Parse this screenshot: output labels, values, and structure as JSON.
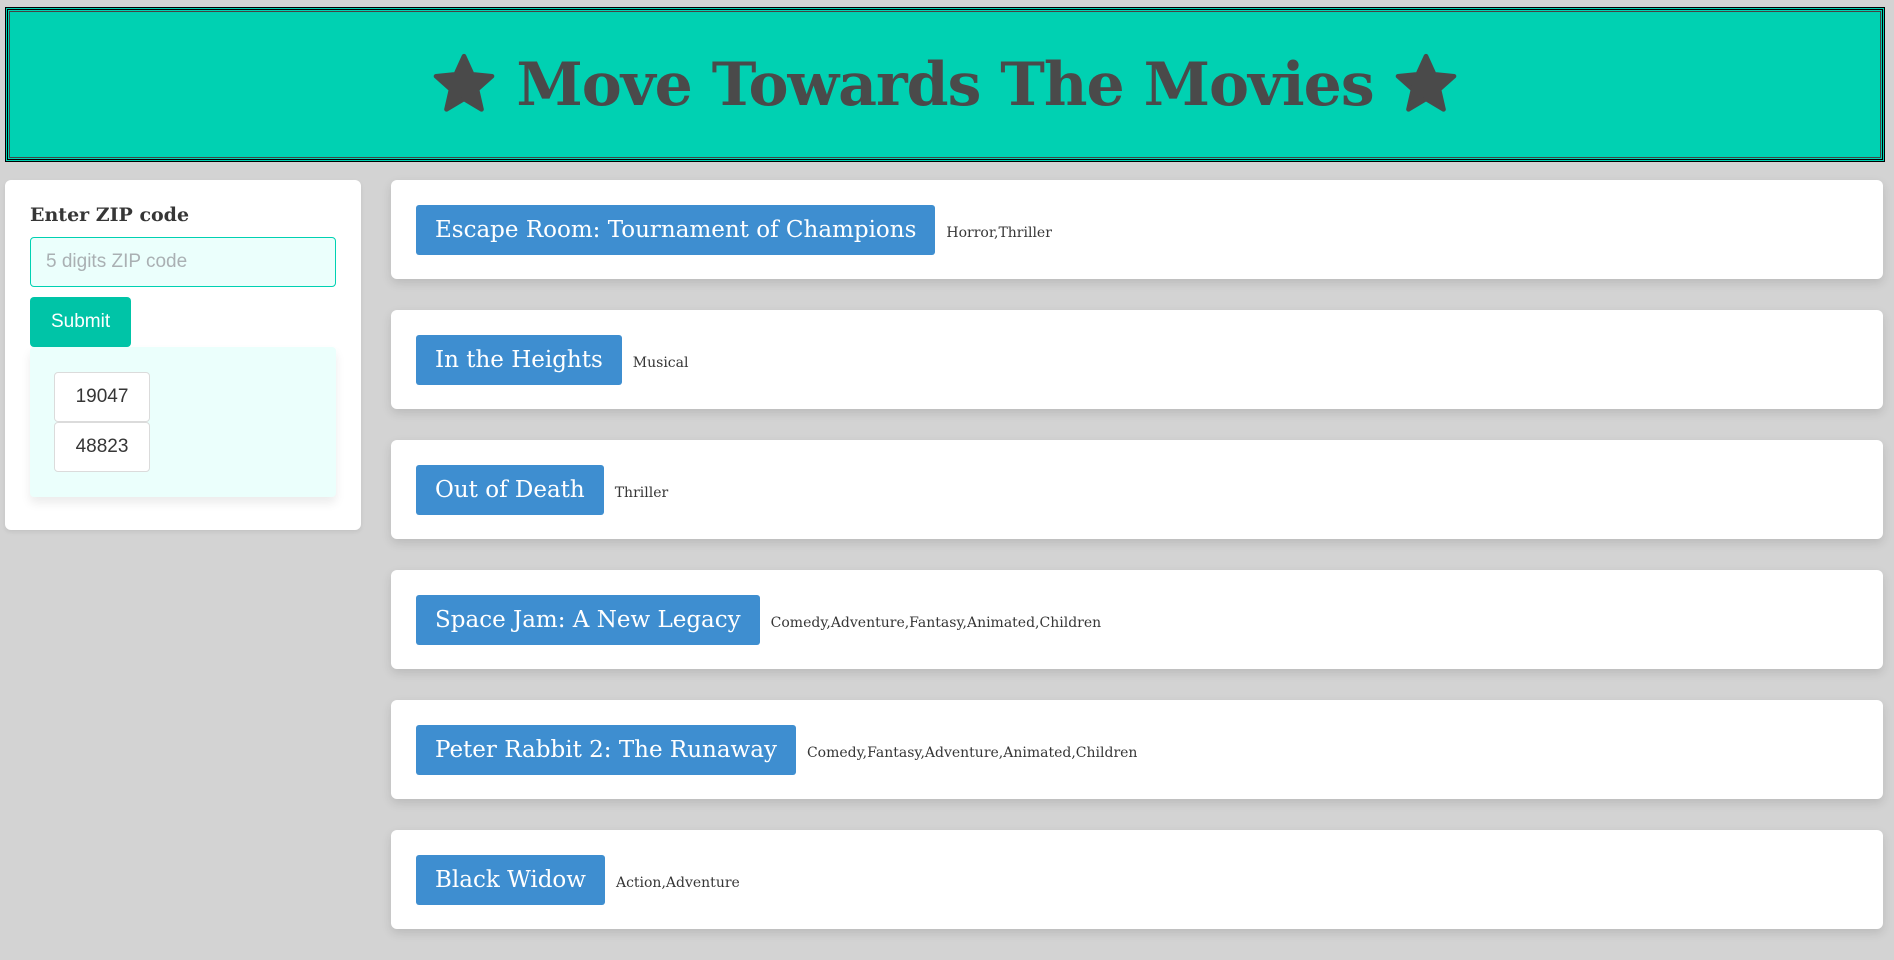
{
  "header": {
    "title": "Move Towards The Movies",
    "star_icon": "star-icon",
    "background_color": "#00d1b2"
  },
  "zip_form": {
    "label": "Enter ZIP code",
    "input_value": "",
    "input_placeholder": "5 digits ZIP code",
    "submit_label": "Submit",
    "history": [
      "19047",
      "48823"
    ]
  },
  "movies": [
    {
      "title": "Escape Room: Tournament of Champions",
      "genres": "Horror,Thriller"
    },
    {
      "title": "In the Heights",
      "genres": "Musical"
    },
    {
      "title": "Out of Death",
      "genres": "Thriller"
    },
    {
      "title": "Space Jam: A New Legacy",
      "genres": "Comedy,Adventure,Fantasy,Animated,Children"
    },
    {
      "title": "Peter Rabbit 2: The Runaway",
      "genres": "Comedy,Fantasy,Adventure,Animated,Children"
    },
    {
      "title": "Black Widow",
      "genres": "Action,Adventure"
    }
  ],
  "colors": {
    "page_background": "#d3d3d3",
    "accent": "#00d1b2",
    "movie_tag": "#3e8ed0"
  }
}
